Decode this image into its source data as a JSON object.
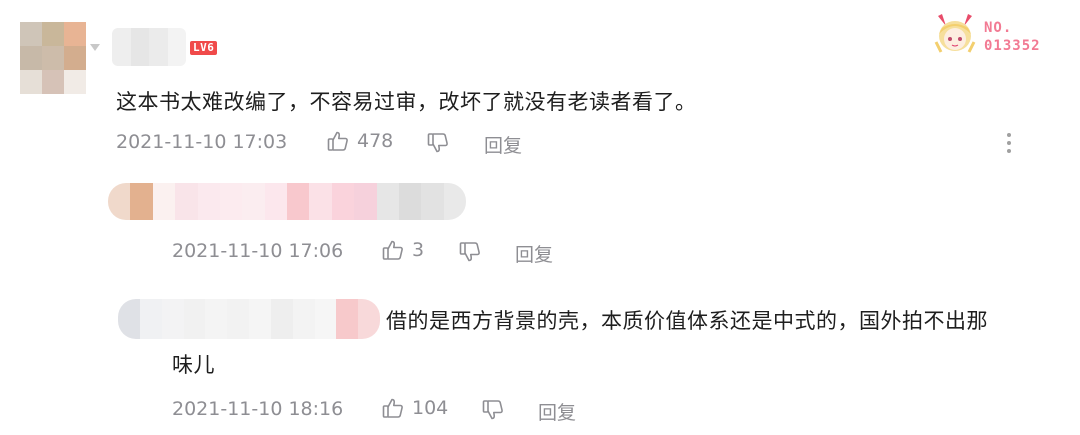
{
  "comments": [
    {
      "level": "LV6",
      "text": "这本书太难改编了，不容易过审，改坏了就没有老读者看了。",
      "timestamp": "2021-11-10 17:03",
      "likes": "478",
      "reply_label": "回复",
      "more_icon": "more-vertical-icon"
    },
    {
      "text": "",
      "timestamp": "2021-11-10 17:06",
      "likes": "3",
      "reply_label": "回复"
    },
    {
      "text_line1": "借的是西方背景的壳，本质价值体系还是中式的，国外拍不出那",
      "text_line2": "味儿",
      "timestamp": "2021-11-10 18:16",
      "likes": "104",
      "reply_label": "回复"
    }
  ],
  "fan_badge": {
    "line1": "NO.",
    "line2": "013352"
  },
  "icons": {
    "like": "thumbs-up-icon",
    "dislike": "thumbs-down-icon"
  },
  "colors": {
    "level_badge": "#f04a4a",
    "fan_badge_text": "#f27a93",
    "meta": "#8e8e93"
  }
}
